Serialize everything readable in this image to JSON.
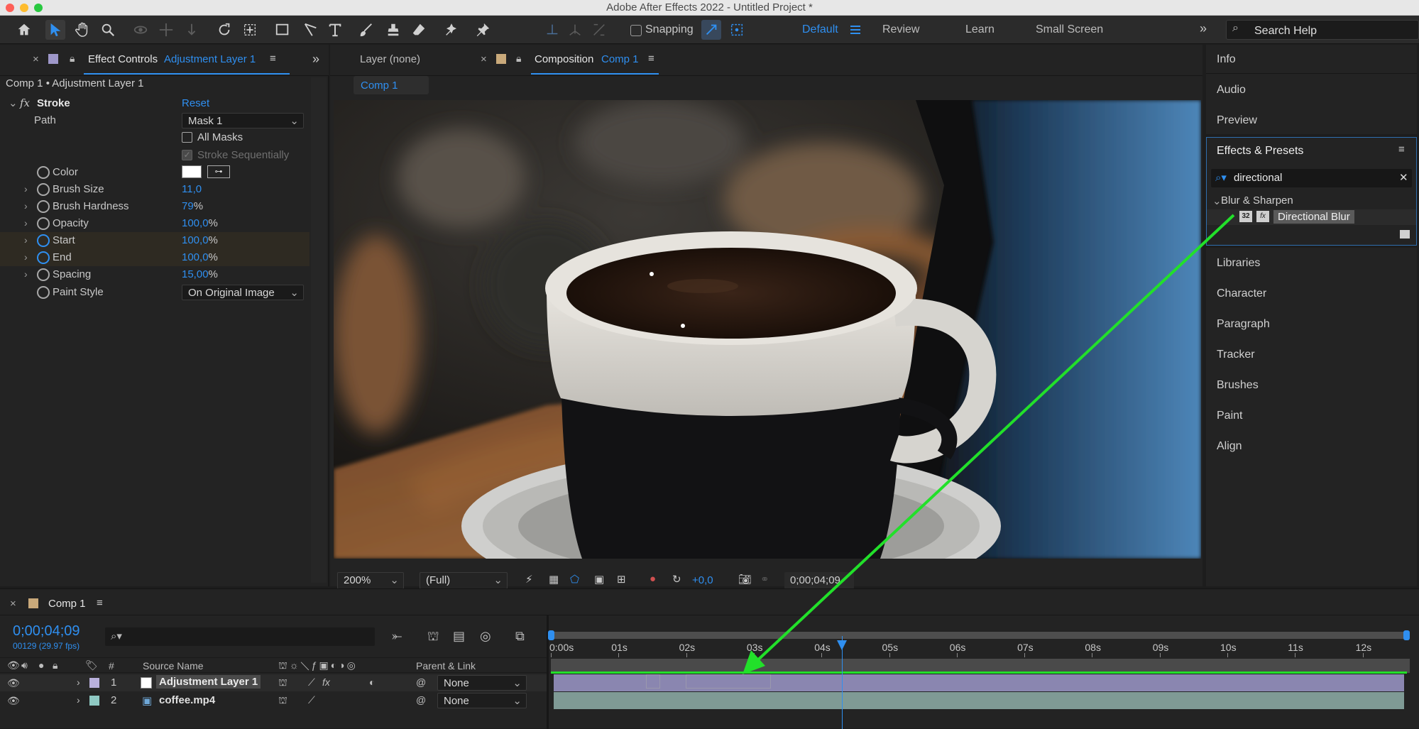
{
  "app": {
    "title": "Adobe After Effects 2022 - Untitled Project *"
  },
  "toolbar": {
    "snapping_label": "Snapping",
    "workspaces": [
      "Default",
      "Review",
      "Learn",
      "Small Screen"
    ],
    "search_placeholder": "Search Help"
  },
  "effect_controls": {
    "tab_label": "Effect Controls",
    "tab_layer": "Adjustment Layer 1",
    "breadcrumb": "Comp 1 • Adjustment Layer 1",
    "effect_name": "Stroke",
    "reset_label": "Reset",
    "path_label": "Path",
    "path_value": "Mask 1",
    "all_masks_label": "All Masks",
    "stroke_seq_label": "Stroke Sequentially",
    "color_label": "Color",
    "properties": [
      {
        "label": "Brush Size",
        "value": "11,0",
        "unit": ""
      },
      {
        "label": "Brush Hardness",
        "value": "79",
        "unit": "%"
      },
      {
        "label": "Opacity",
        "value": "100,0",
        "unit": "%"
      },
      {
        "label": "Start",
        "value": "100,0",
        "unit": "%"
      },
      {
        "label": "End",
        "value": "100,0",
        "unit": "%"
      },
      {
        "label": "Spacing",
        "value": "15,00",
        "unit": "%"
      }
    ],
    "paint_style_label": "Paint Style",
    "paint_style_value": "On Original Image"
  },
  "viewer": {
    "layer_tab": "Layer (none)",
    "comp_tab_label": "Composition",
    "comp_tab_name": "Comp 1",
    "comp_pill": "Comp 1",
    "zoom": "200%",
    "resolution": "(Full)",
    "exposure": "+0,0",
    "timecode": "0;00;04;09"
  },
  "right_panel": {
    "top_items": [
      "Info",
      "Audio",
      "Preview"
    ],
    "effects_presets_title": "Effects & Presets",
    "search_value": "directional",
    "category": "Blur & Sharpen",
    "effect_item": "Directional Blur",
    "badge_32": "32",
    "badge_fx": "fx",
    "bottom_items": [
      "Libraries",
      "Character",
      "Paragraph",
      "Tracker",
      "Brushes",
      "Paint",
      "Align"
    ]
  },
  "timeline": {
    "tab_name": "Comp 1",
    "current_time": "0;00;04;09",
    "frame_info": "00129 (29.97 fps)",
    "header_num": "#",
    "header_source": "Source Name",
    "header_parent": "Parent & Link",
    "ruler": [
      "0:00s",
      "01s",
      "02s",
      "03s",
      "04s",
      "05s",
      "06s",
      "07s",
      "08s",
      "09s",
      "10s",
      "11s",
      "12s"
    ],
    "playhead_seconds": 4.3,
    "layers": [
      {
        "num": "1",
        "name": "Adjustment Layer 1",
        "parent": "None",
        "swatch": "#b9b0dc"
      },
      {
        "num": "2",
        "name": "coffee.mp4",
        "parent": "None",
        "swatch": "#8fc9c3"
      }
    ]
  },
  "colors": {
    "accent": "#2f8ff0",
    "annotation": "#22e02a",
    "panel": "#232323",
    "layer1_bar": "#8a86b0",
    "layer2_bar": "#7f9a95"
  }
}
